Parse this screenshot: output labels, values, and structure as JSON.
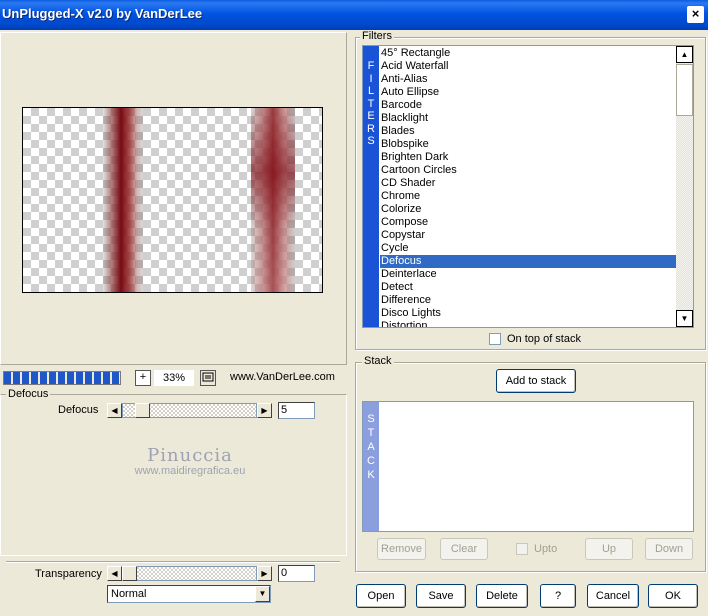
{
  "window": {
    "title": "UnPlugged-X v2.0 by VanDerLee",
    "close_label": "×"
  },
  "preview": {
    "progress_fraction": 1.0,
    "zoom_in_label": "+",
    "zoom_value": "33%",
    "website": "www.VanDerLee.com"
  },
  "defocus_group": {
    "title": "Defocus",
    "param_label": "Defocus",
    "param_value": "5",
    "watermark_name": "Pinuccia",
    "watermark_url": "www.maidiregrafica.eu"
  },
  "transparency": {
    "label": "Transparency",
    "value": "0"
  },
  "blend_mode": {
    "selected": "Normal"
  },
  "filters": {
    "title": "Filters",
    "strip_label": "FILTERS",
    "items": [
      "45° Rectangle",
      "Acid Waterfall",
      "Anti-Alias",
      "Auto Ellipse",
      "Barcode",
      "Blacklight",
      "Blades",
      "Blobspike",
      "Brighten Dark",
      "Cartoon Circles",
      "CD Shader",
      "Chrome",
      "Colorize",
      "Compose",
      "Copystar",
      "Cycle",
      "Defocus",
      "Deinterlace",
      "Detect",
      "Difference",
      "Disco Lights",
      "Distortion"
    ],
    "selected_index": 16,
    "on_top_label": "On top of stack"
  },
  "stack": {
    "title": "Stack",
    "strip_label": "STACK",
    "add_button": "Add to stack",
    "remove_button": "Remove",
    "clear_button": "Clear",
    "upto_label": "Upto",
    "up_button": "Up",
    "down_button": "Down"
  },
  "footer": {
    "open": "Open",
    "save": "Save",
    "delete": "Delete",
    "help": "?",
    "cancel": "Cancel",
    "ok": "OK"
  }
}
